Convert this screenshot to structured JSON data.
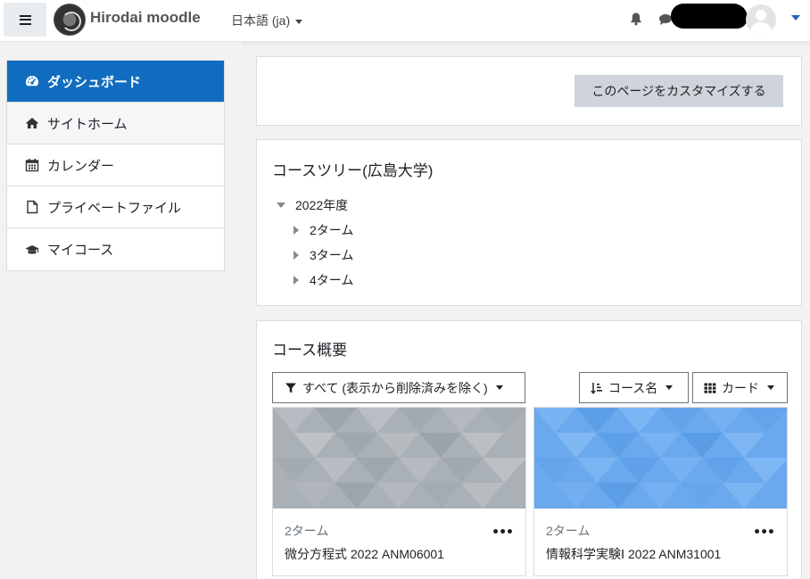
{
  "navbar": {
    "brand": "Hirodai moodle",
    "language": "日本語 (ja)"
  },
  "nav": {
    "items": [
      {
        "label": "ダッシュボード",
        "icon": "tachometer-icon"
      },
      {
        "label": "サイトホーム",
        "icon": "home-icon"
      },
      {
        "label": "カレンダー",
        "icon": "calendar-icon"
      },
      {
        "label": "プライベートファイル",
        "icon": "file-icon"
      },
      {
        "label": "マイコース",
        "icon": "graduation-cap-icon"
      }
    ]
  },
  "customize": {
    "button_label": "このページをカスタマイズする"
  },
  "course_tree": {
    "title": "コースツリー(広島大学)",
    "year": "2022年度",
    "terms": [
      "2ターム",
      "3ターム",
      "4ターム"
    ]
  },
  "course_overview": {
    "title": "コース概要",
    "filter_label": "すべて (表示から削除済みを除く)",
    "sort_label": "コース名",
    "view_label": "カード",
    "courses": [
      {
        "category": "2ターム",
        "name": "微分方程式 2022 ANM06001",
        "color": "#a9b0b6"
      },
      {
        "category": "2ターム",
        "name": "情報科学実験Ⅰ 2022 ANM31001",
        "color": "#6aa9ee"
      }
    ]
  },
  "colors": {
    "accent": "#0f6cbf",
    "button_gray": "#ced4da"
  }
}
